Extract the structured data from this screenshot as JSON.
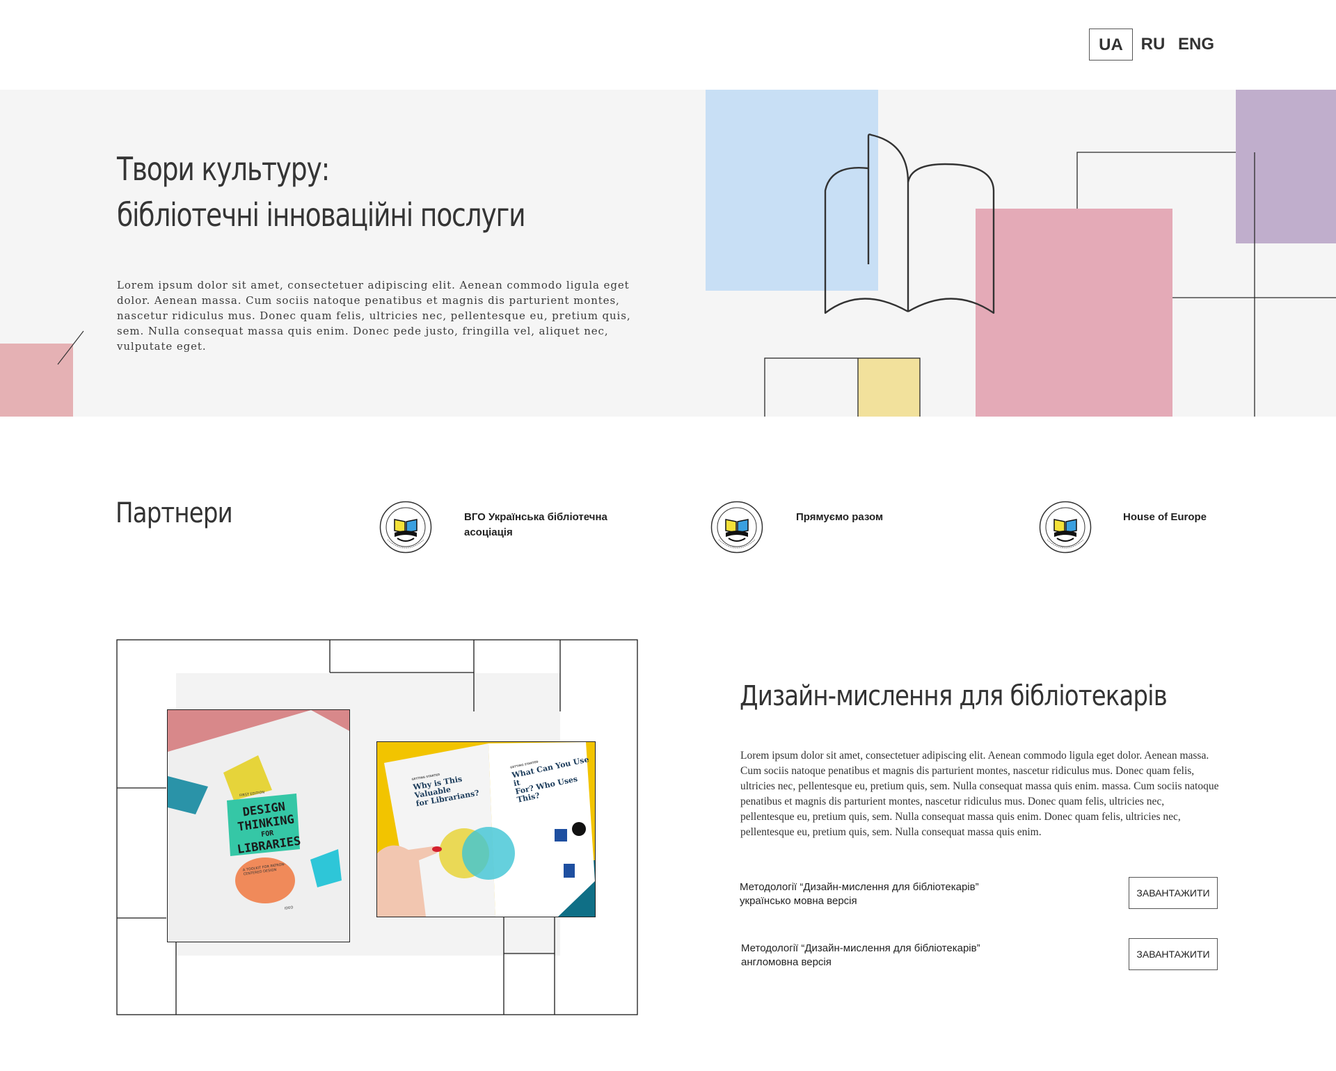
{
  "languages": [
    {
      "label": "UA",
      "active": true
    },
    {
      "label": "RU",
      "active": false
    },
    {
      "label": "ENG",
      "active": false
    }
  ],
  "hero": {
    "title_line1": "Твори культуру:",
    "title_line2": "бібліотечні інноваційні послуги",
    "text": "Lorem ipsum dolor sit amet, consectetuer adipiscing elit. Aenean commodo ligula eget dolor. Aenean massa. Cum sociis natoque penatibus et magnis dis parturient montes, nascetur ridiculus mus. Donec quam felis, ultricies nec, pellentesque eu, pretium quis, sem. Nulla consequat massa quis enim. Donec pede justo, fringilla vel, aliquet nec, vulputate eget."
  },
  "colors": {
    "hero_bg": "#f5f5f5",
    "blue": "#c8dff5",
    "pink": "#e4aab7",
    "purple": "#c0aecc",
    "yellow": "#f2e19c",
    "rose": "#e5b1b4"
  },
  "partners": {
    "title": "Партнери",
    "items": [
      {
        "name_line1": "ВГО Українська бібліотечна",
        "name_line2": "асоціація",
        "icon": "library-association-logo"
      },
      {
        "name_line1": "Прямуємо разом",
        "name_line2": "",
        "icon": "library-association-logo"
      },
      {
        "name_line1": "House of Europe",
        "name_line2": "",
        "icon": "library-association-logo"
      }
    ]
  },
  "design": {
    "title": "Дизайн-мислення для бібліотекарів",
    "text": "Lorem ipsum dolor sit amet, consectetuer adipiscing elit. Aenean commodo ligula eget dolor. Aenean massa. Cum sociis natoque penatibus et magnis dis parturient montes, nascetur ridiculus mus. Donec quam felis, ultricies nec, pellentesque eu, pretium quis, sem. Nulla consequat massa quis enim. massa. Cum sociis natoque penatibus et magnis dis parturient montes, nascetur ridiculus mus. Donec quam felis, ultricies nec, pellentesque eu, pretium quis, sem. Nulla consequat massa quis enim. Donec quam felis, ultricies nec, pellentesque eu, pretium quis, sem. Nulla consequat massa quis enim.",
    "downloads": [
      {
        "label_line1": "Методології “Дизайн-мислення для бібліотекарів”",
        "label_line2": "українсько мовна версія",
        "button": "ЗАВАНТАЖИТИ"
      },
      {
        "label_line1": "Методології “Дизайн-мислення для бібліотекарів”",
        "label_line2": "англомовна версія",
        "button": "ЗАВАНТАЖИТИ"
      }
    ],
    "book_cover": {
      "line1": "DESIGN",
      "line2": "THINKING",
      "line3": "FOR",
      "line4": "LIBRARIES",
      "edition": "FIRST EDITION",
      "subtitle": "A TOOLKIT FOR PATRON-CENTERED DESIGN",
      "publisher": "IDEO"
    },
    "open_book": {
      "left_kicker": "GETTING STARTED",
      "left_heading_line1": "Why is This Valuable",
      "left_heading_line2": "for Librarians?",
      "right_kicker": "GETTING STARTED",
      "right_heading_line1": "What Can You Use it",
      "right_heading_line2": "For? Who Uses This?"
    }
  }
}
